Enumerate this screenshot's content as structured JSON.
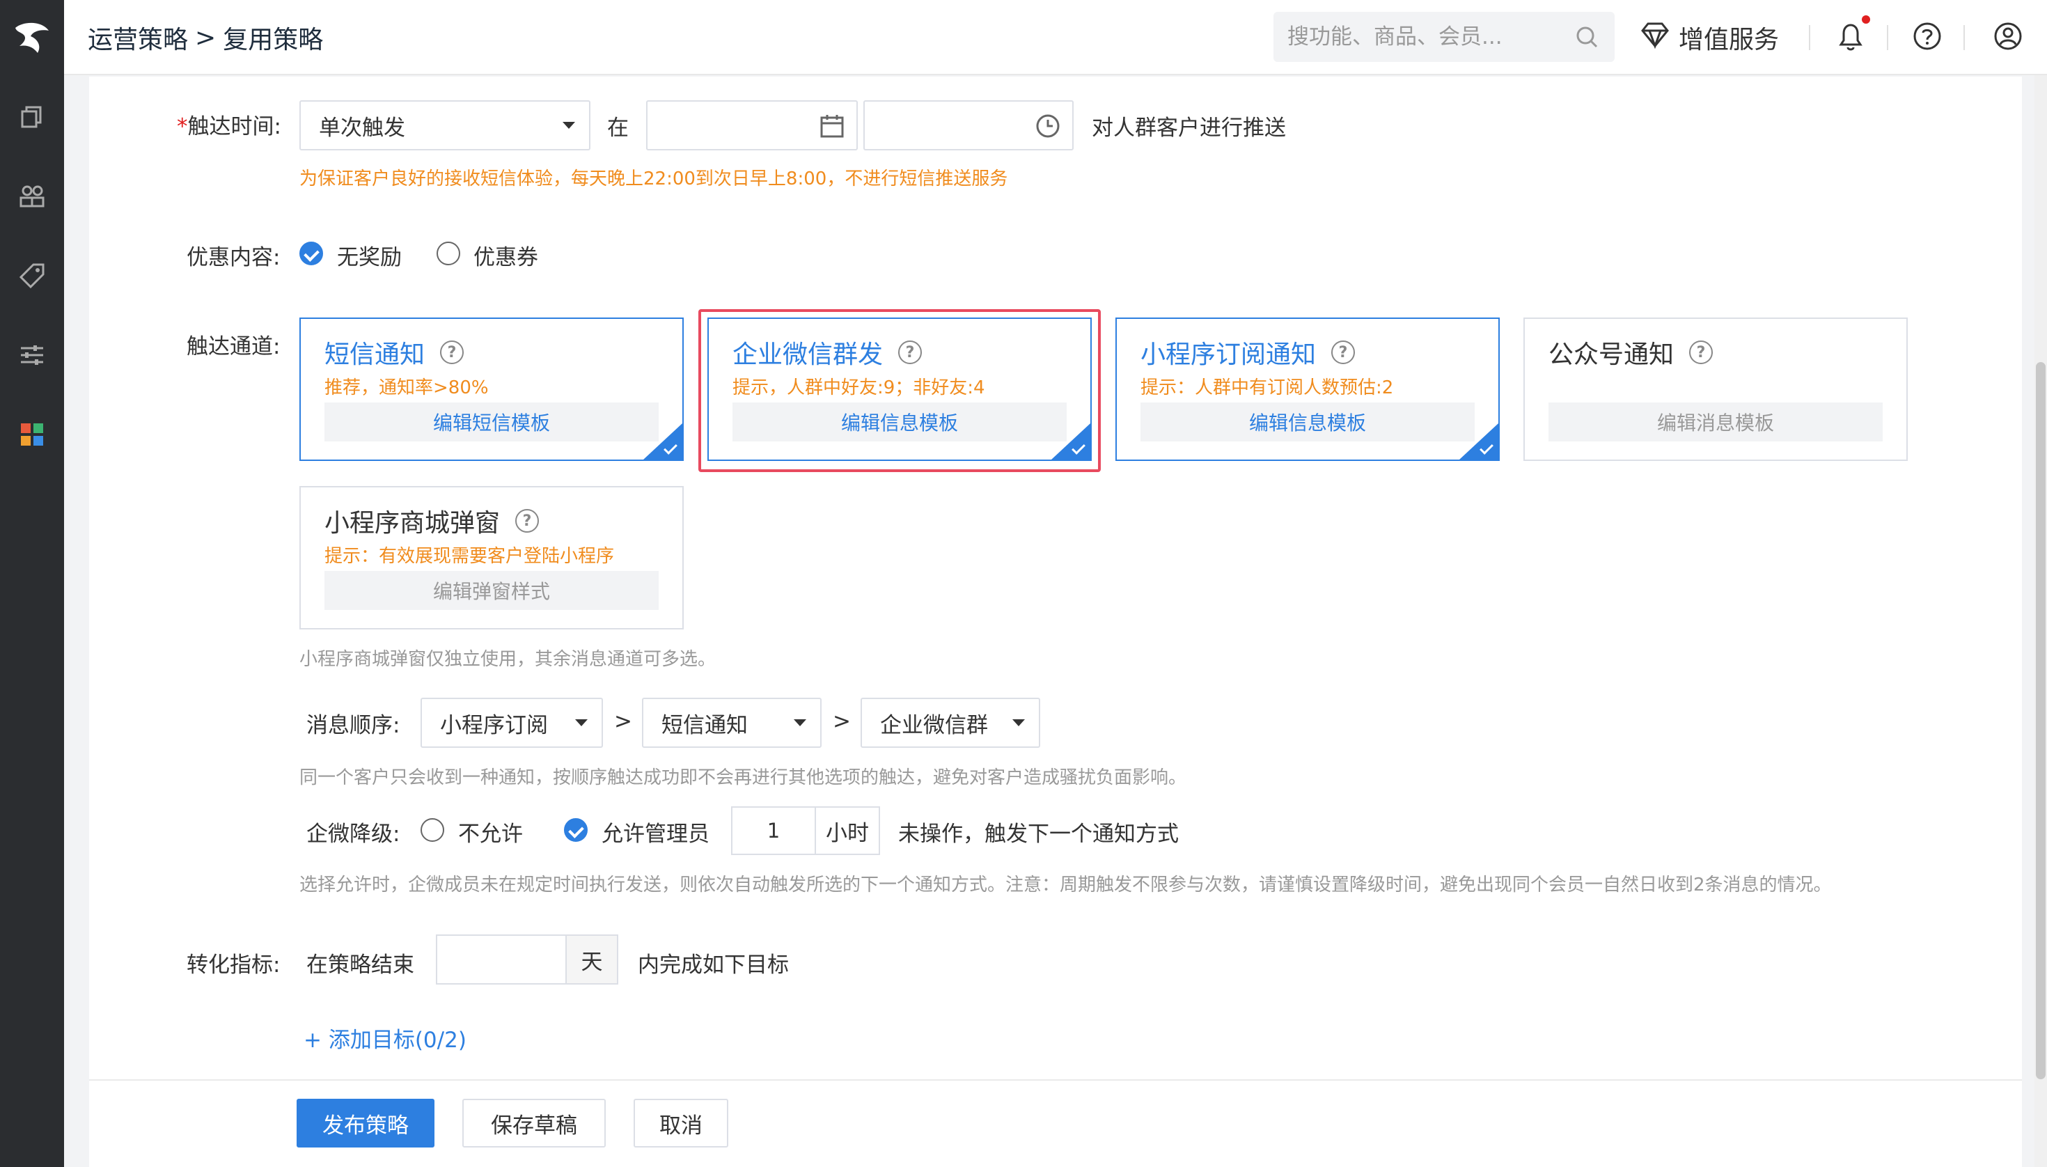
{
  "breadcrumb": {
    "parent": "运营策略",
    "separator": ">",
    "current": "复用策略"
  },
  "header": {
    "search_placeholder": "搜功能、商品、会员...",
    "vas_label": "增值服务"
  },
  "form": {
    "reach_time": {
      "label": "触达时间:",
      "required_mark": "*",
      "trigger_select": "单次触发",
      "at": "在",
      "date_value": "",
      "time_value": "",
      "suffix": "对人群客户进行推送",
      "warning": "为保证客户良好的接收短信体验，每天晚上22:00到次日早上8:00，不进行短信推送服务"
    },
    "discount": {
      "label": "优惠内容:",
      "options": [
        {
          "label": "无奖励",
          "checked": true
        },
        {
          "label": "优惠券",
          "checked": false
        }
      ]
    },
    "channels": {
      "label": "触达通道:",
      "cards": [
        {
          "title": "短信通知",
          "sub": "推荐，通知率>80%",
          "button": "编辑短信模板",
          "selected": true
        },
        {
          "title": "企业微信群发",
          "sub": "提示，人群中好友:9；非好友:4",
          "button": "编辑信息模板",
          "selected": true
        },
        {
          "title": "小程序订阅通知",
          "sub": "提示：人群中有订阅人数预估:2",
          "button": "编辑信息模板",
          "selected": true
        },
        {
          "title": "公众号通知",
          "sub": "",
          "button": "编辑消息模板",
          "selected": false
        },
        {
          "title": "小程序商城弹窗",
          "sub": "提示：有效展现需要客户登陆小程序",
          "button": "编辑弹窗样式",
          "selected": false
        }
      ],
      "hint": "小程序商城弹窗仅独立使用，其余消息通道可多选。"
    },
    "order": {
      "label": "消息顺序:",
      "items": [
        "小程序订阅",
        "短信通知",
        "企业微信群"
      ],
      "separator": ">",
      "hint": "同一个客户只会收到一种通知，按顺序触达成功即不会再进行其他选项的触达，避免对客户造成骚扰负面影响。"
    },
    "downgrade": {
      "label": "企微降级:",
      "options": [
        {
          "label": "不允许",
          "checked": false
        },
        {
          "label": "允许管理员",
          "checked": true
        }
      ],
      "hours": "1",
      "unit": "小时",
      "suffix": "未操作，触发下一个通知方式",
      "hint": "选择允许时，企微成员未在规定时间执行发送，则依次自动触发所选的下一个通知方式。注意：周期触发不限参与次数，请谨慎设置降级时间，避免出现同个会员一自然日收到2条消息的情况。"
    },
    "conversion": {
      "label": "转化指标:",
      "prefix": "在策略结束",
      "days": "",
      "unit": "天",
      "suffix": "内完成如下目标",
      "add_target": "+ 添加目标(0/2)"
    }
  },
  "footer": {
    "publish": "发布策略",
    "save_draft": "保存草稿",
    "cancel": "取消"
  },
  "colors": {
    "accent": "#2d7fe0",
    "warning": "#f08c1e",
    "highlight": "#e84a5f",
    "sidebar": "#2b2d30"
  }
}
